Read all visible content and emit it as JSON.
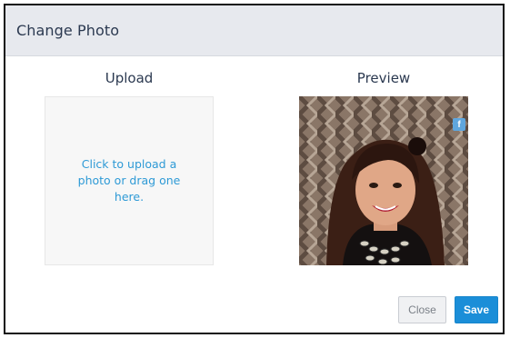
{
  "dialog": {
    "title": "Change Photo"
  },
  "upload": {
    "label": "Upload",
    "dropzone_text": "Click to upload a photo or drag one here."
  },
  "preview": {
    "label": "Preview",
    "badge_text": "f",
    "badge_icon": "facebook-icon"
  },
  "buttons": {
    "close_label": "Close",
    "save_label": "Save"
  },
  "colors": {
    "header_bg": "#e7e9ee",
    "link_blue": "#2e9ad6",
    "save_blue": "#1b8ed8"
  }
}
